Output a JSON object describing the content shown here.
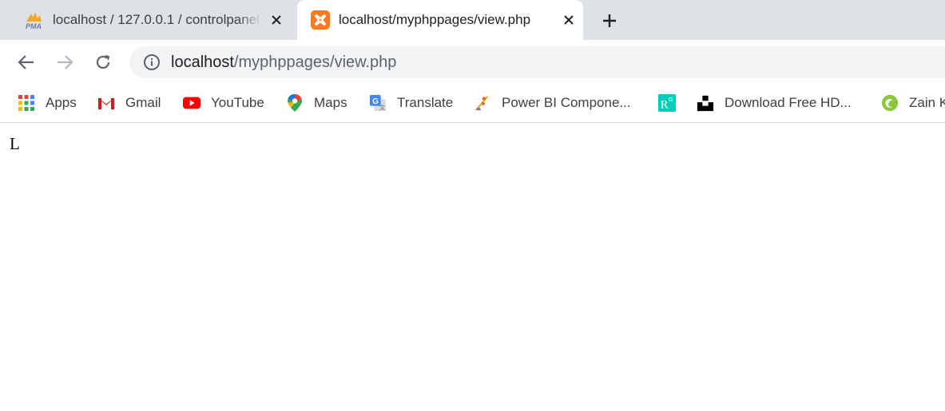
{
  "tabs": [
    {
      "title": "localhost / 127.0.0.1 / controlpanel",
      "favicon": "phpmyadmin-icon",
      "active": false
    },
    {
      "title": "localhost/myphppages/view.php",
      "favicon": "xampp-icon",
      "active": true
    }
  ],
  "toolbar": {
    "url_host": "localhost",
    "url_path": "/myphppages/view.php"
  },
  "bookmarks": [
    {
      "label": "Apps",
      "icon": "apps-grid-icon"
    },
    {
      "label": "Gmail",
      "icon": "gmail-icon"
    },
    {
      "label": "YouTube",
      "icon": "youtube-icon"
    },
    {
      "label": "Maps",
      "icon": "maps-icon"
    },
    {
      "label": "Translate",
      "icon": "translate-icon"
    },
    {
      "label": "Power BI Compone...",
      "icon": "powerbi-icon"
    },
    {
      "label": "",
      "icon": "researchgate-icon"
    },
    {
      "label": "Download Free HD...",
      "icon": "unsplash-icon"
    },
    {
      "label": "Zain K",
      "icon": "zain-icon"
    }
  ],
  "page": {
    "text": "L"
  },
  "colors": {
    "tabstrip_bg": "#dee1e6",
    "omnibox_bg": "#f1f3f4",
    "xampp_orange": "#fb7a24",
    "youtube_red": "#ff0000",
    "researchgate_teal": "#00ccbb"
  }
}
